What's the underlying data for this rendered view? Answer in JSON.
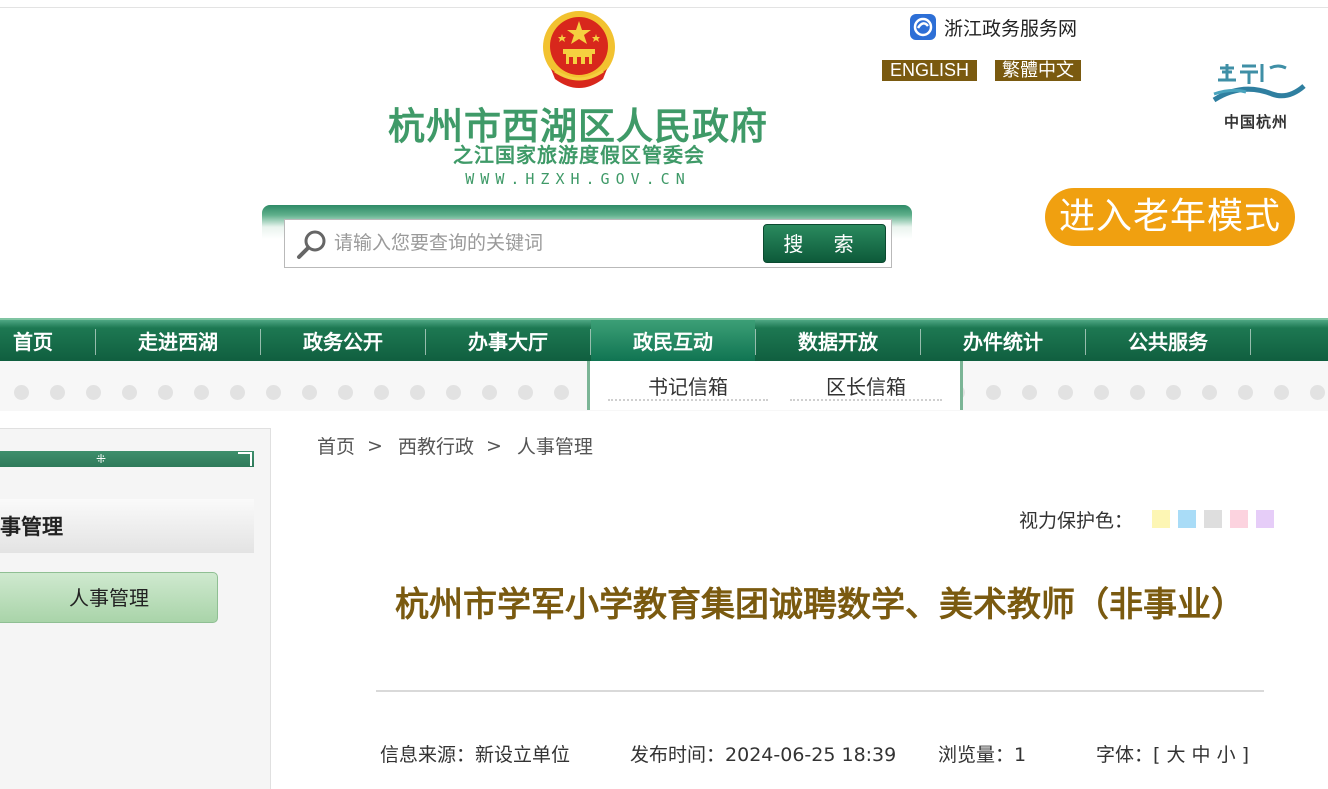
{
  "header": {
    "site_title": "杭州市西湖区人民政府",
    "site_subtitle": "之江国家旅游度假区管委会",
    "site_url": "WWW.HZXH.GOV.CN",
    "zj_service_label": "浙江政务服务网",
    "lang_english": "ENGLISH",
    "lang_traditional": "繁體中文",
    "hz_logo_text": "中国杭州",
    "elder_mode_label": "进入老年模式"
  },
  "search": {
    "placeholder": "请输入您要查询的关键词",
    "button_label": "搜 索"
  },
  "nav": {
    "items": [
      "首页",
      "走进西湖",
      "政务公开",
      "办事大厅",
      "政民互动",
      "数据开放",
      "办件统计",
      "公共服务"
    ],
    "active": "政民互动"
  },
  "submenu": {
    "items": [
      "书记信箱",
      "区长信箱"
    ]
  },
  "sidebar": {
    "heading": "人事管理",
    "items": [
      "人事管理"
    ]
  },
  "breadcrumb": {
    "items": [
      "首页",
      "西教行政",
      "人事管理"
    ],
    "separator": ">"
  },
  "eye_protection": {
    "label": "视力保护色：",
    "colors": [
      "#fdf6b4",
      "#a9dcf7",
      "#dedede",
      "#fcd3df",
      "#e6cdf8"
    ]
  },
  "article": {
    "title": "杭州市学军小学教育集团诚聘数学、美术教师（非事业）",
    "source_label": "信息来源：",
    "source_value": "新设立单位",
    "publish_label": "发布时间：",
    "publish_value": "2024-06-25 18:39",
    "views_label": "浏览量：",
    "views_value": "1",
    "font_label": "字体：",
    "font_open": "[",
    "font_large": "大",
    "font_medium": "中",
    "font_small": "小",
    "font_close": "]"
  }
}
